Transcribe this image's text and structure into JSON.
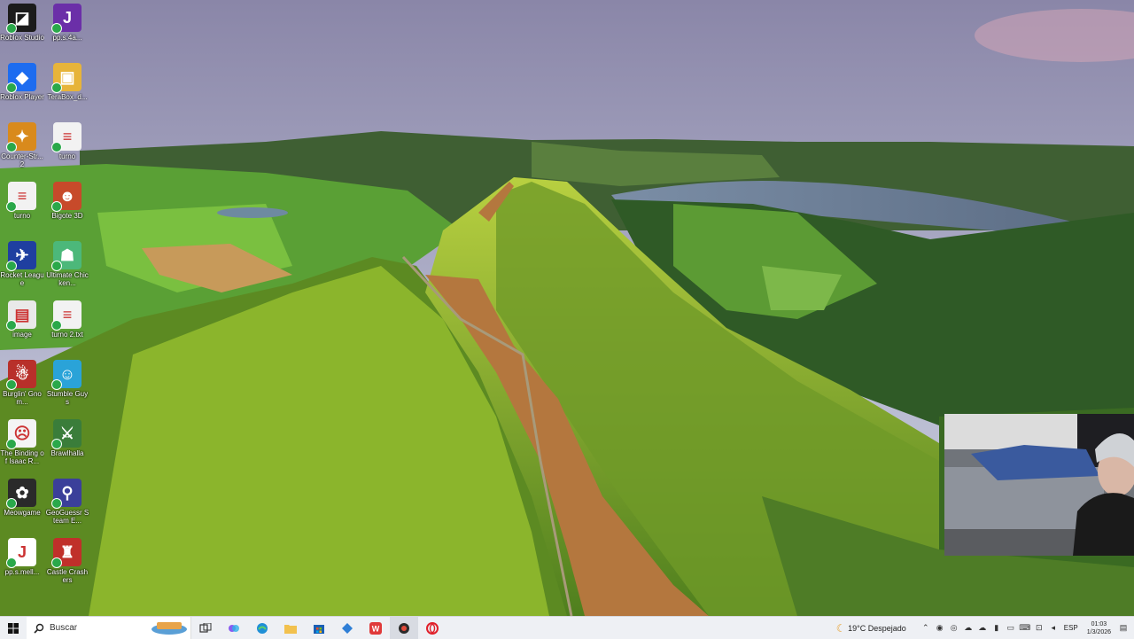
{
  "desktop": {
    "icons": [
      {
        "label": "Roblox Studio",
        "color": "#1b1b1b",
        "glyph": "◪",
        "icon": "roblox-studio-icon"
      },
      {
        "label": "pp.s.4a...",
        "color": "#6b2fa8",
        "glyph": "J",
        "icon": "app-icon"
      },
      {
        "label": "Roblox Player",
        "color": "#1d6cf0",
        "glyph": "◆",
        "icon": "roblox-player-icon"
      },
      {
        "label": "TeraBox_d...",
        "color": "#e7b43a",
        "glyph": "▣",
        "icon": "folder-icon"
      },
      {
        "label": "Counter-Str... 2",
        "color": "#d98a1c",
        "glyph": "✦",
        "icon": "counter-strike-icon"
      },
      {
        "label": "turno",
        "color": "#f2f2f2",
        "glyph": "≡",
        "icon": "document-icon"
      },
      {
        "label": "turno",
        "color": "#f2f2f2",
        "glyph": "≡",
        "icon": "document-icon"
      },
      {
        "label": "Bigote 3D",
        "color": "#c74a2a",
        "glyph": "☻",
        "icon": "game-icon"
      },
      {
        "label": "Rocket League",
        "color": "#1f3fa0",
        "glyph": "✈",
        "icon": "rocket-league-icon"
      },
      {
        "label": "Ultimate Chicken...",
        "color": "#4cb87a",
        "glyph": "☗",
        "icon": "game-icon"
      },
      {
        "label": "image",
        "color": "#e9e9e9",
        "glyph": "▤",
        "icon": "image-icon"
      },
      {
        "label": "turno 2.txt",
        "color": "#f2f2f2",
        "glyph": "≡",
        "icon": "document-icon"
      },
      {
        "label": "Burglin' Gnom...",
        "color": "#b8302a",
        "glyph": "☃",
        "icon": "game-icon"
      },
      {
        "label": "Stumble Guys",
        "color": "#2aa3d8",
        "glyph": "☺",
        "icon": "game-icon"
      },
      {
        "label": "The Binding of Isaac R...",
        "color": "#f4f4f4",
        "glyph": "☹",
        "icon": "game-icon"
      },
      {
        "label": "Brawlhalla",
        "color": "#3a7d3a",
        "glyph": "⚔",
        "icon": "game-icon"
      },
      {
        "label": "Meowgame",
        "color": "#2a2a2a",
        "glyph": "✿",
        "icon": "game-icon"
      },
      {
        "label": "GeoGuessr Steam E...",
        "color": "#3b3f9a",
        "glyph": "⚲",
        "icon": "geoguessr-icon"
      },
      {
        "label": "pp.s.mell...",
        "color": "#ffffff",
        "glyph": "J",
        "icon": "app-icon"
      },
      {
        "label": "Castle Crashers",
        "color": "#c0302a",
        "glyph": "♜",
        "icon": "game-icon"
      }
    ]
  },
  "taskbar": {
    "search_placeholder": "Buscar",
    "weather": "19°C Despejado",
    "language": "ESP",
    "time": "01:03",
    "date": "1/3/2026"
  },
  "colors": {
    "accent": "#0078d4",
    "taskbar_bg": "#eef0f4"
  }
}
